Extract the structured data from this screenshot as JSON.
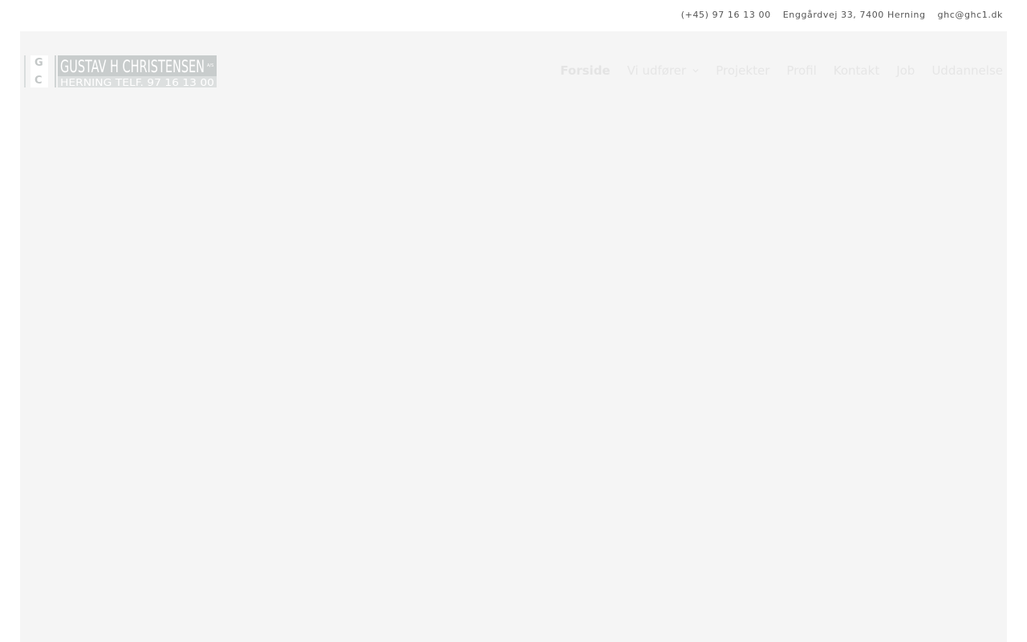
{
  "topbar": {
    "phone": "(+45) 97 16 13 00",
    "address": "Enggårdvej 33, 7400 Herning",
    "email": "ghc@ghc1.dk"
  },
  "logo": {
    "letters": [
      "G",
      "C"
    ],
    "name": "GUSTAV H CHRISTENSEN",
    "suffix": "A/S",
    "subline": "HERNING TELF. 97 16 13 00"
  },
  "nav": {
    "items": [
      {
        "label": "Forside"
      },
      {
        "label": "Vi udfører"
      },
      {
        "label": "Projekter"
      },
      {
        "label": "Profil"
      },
      {
        "label": "Kontakt"
      },
      {
        "label": "Job"
      },
      {
        "label": "Uddannelse"
      }
    ],
    "dropdown_icon": "chevron-down-icon"
  },
  "colors": {
    "page_bg": "#ffffff",
    "hero_bg": "#f5f5f5",
    "nav_text": "#e6e6e6",
    "logo_grey": "#c8cccc",
    "topbar_text": "#555555"
  }
}
